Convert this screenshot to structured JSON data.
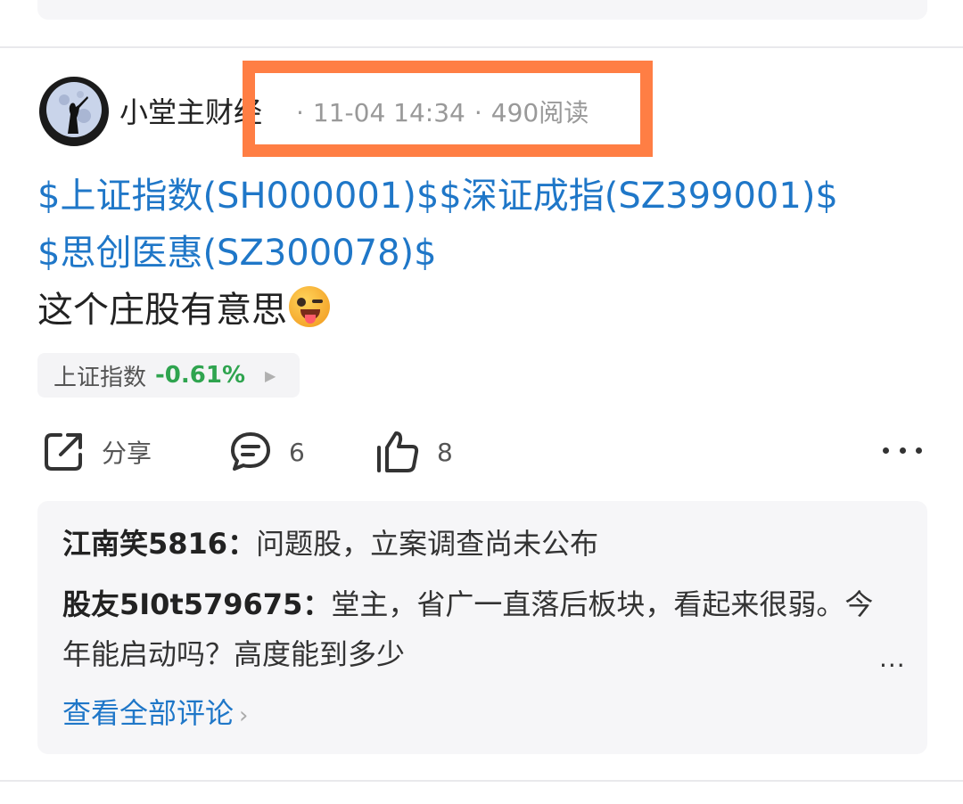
{
  "post": {
    "author": "小堂主财经",
    "time": "11-04 14:34",
    "reads": "490阅读",
    "stock_tag_1": "$上证指数(SH000001)$",
    "stock_tag_2": "$深证成指(SZ399001)$",
    "stock_tag_3": "$思创医惠(SZ300078)$",
    "text": "这个庄股有意思",
    "emoji": "winking-face-with-tongue"
  },
  "quote_chip": {
    "name": "上证指数",
    "change": "-0.61%",
    "change_color": "#2fa44f"
  },
  "actions": {
    "share_label": "分享",
    "comment_count": "6",
    "like_count": "8"
  },
  "comments": {
    "items": [
      {
        "user": "江南笑5816：",
        "text": "问题股，立案调查尚未公布"
      },
      {
        "user": "股友5I0t579675：",
        "text": "堂主，省广一直落后板块，看起来很弱。今年能启动吗？高度能到多少"
      }
    ],
    "overflow": "...",
    "view_all": "查看全部评论"
  },
  "colors": {
    "link": "#1f77c8",
    "highlight_box": "#ff7e44",
    "meta_text": "#999999"
  }
}
